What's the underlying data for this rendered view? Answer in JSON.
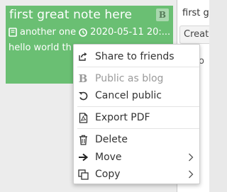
{
  "note": {
    "title": "first great note here",
    "badge": "B",
    "notebook": "another one",
    "datetime": "2020-05-11 20:...",
    "preview": "hello world th"
  },
  "editor": {
    "title": "first gr",
    "button_label": "Creat",
    "tail": "o"
  },
  "menu": {
    "share": "Share to friends",
    "public_blog": "Public as blog",
    "cancel_public": "Cancel public",
    "export_pdf": "Export PDF",
    "delete": "Delete",
    "move": "Move",
    "copy": "Copy"
  },
  "colors": {
    "note_card_bg": "#6abf73",
    "disabled_text": "#9a9a9a"
  }
}
